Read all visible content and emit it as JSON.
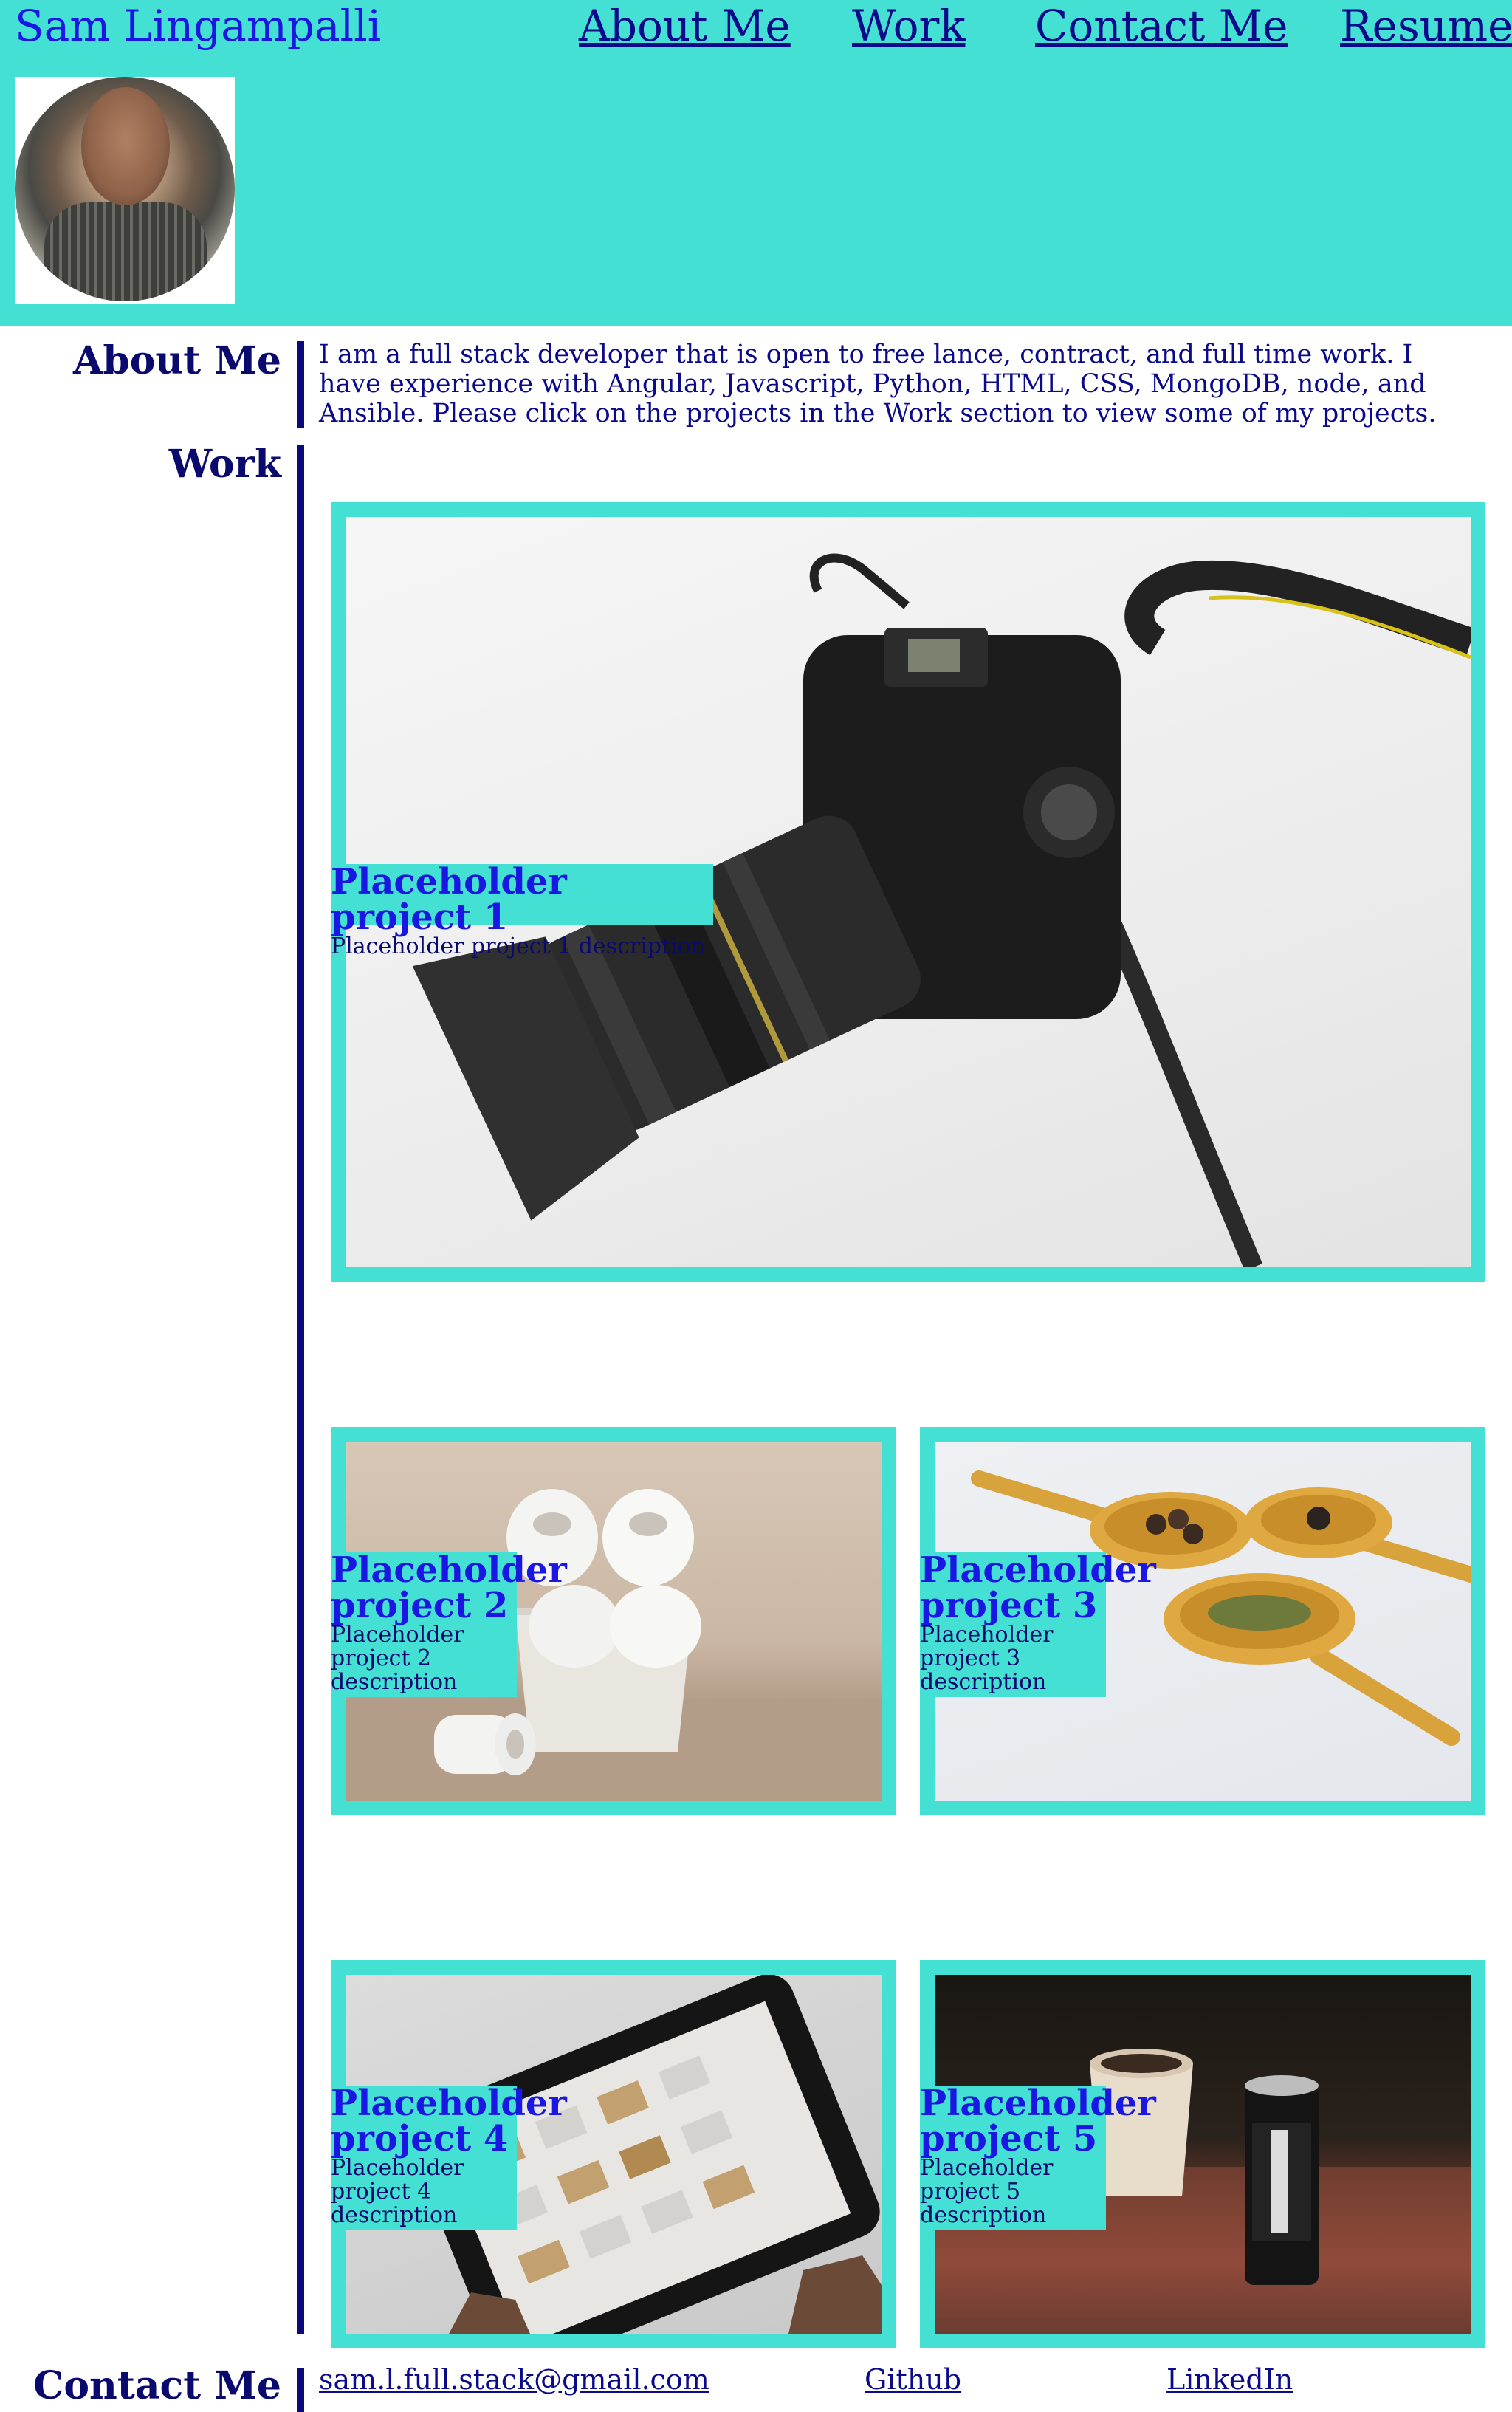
{
  "header": {
    "site_title": "Sam Lingampalli",
    "nav": [
      "About Me",
      "Work",
      "Contact Me",
      "Resume"
    ]
  },
  "about": {
    "heading": "About Me",
    "text": "I am a full stack developer that is open to free lance, contract, and full time work. I have experience with Angular, Javascript, Python, HTML, CSS, MongoDB, node, and Ansible. Please click on the projects in the Work section to view some of my projects."
  },
  "work": {
    "heading": "Work",
    "projects": [
      {
        "title": "Placeholder project 1",
        "description": "Placeholder project 1 description",
        "image": "camera"
      },
      {
        "title": "Placeholder project 2",
        "description": "Placeholder project 2 description",
        "image": "toilet-paper"
      },
      {
        "title": "Placeholder project 3",
        "description": "Placeholder project 3 description",
        "image": "spoons"
      },
      {
        "title": "Placeholder project 4",
        "description": "Placeholder project 4 description",
        "image": "tablet"
      },
      {
        "title": "Placeholder project 5",
        "description": "Placeholder project 5 description",
        "image": "coffee"
      }
    ]
  },
  "contact": {
    "heading": "Contact Me",
    "links": [
      "sam.l.full.stack@gmail.com",
      "Github",
      "LinkedIn"
    ]
  },
  "colors": {
    "accent": "#43E0D3",
    "title_blue": "#1B17E3",
    "navy": "#0A0A8A"
  }
}
